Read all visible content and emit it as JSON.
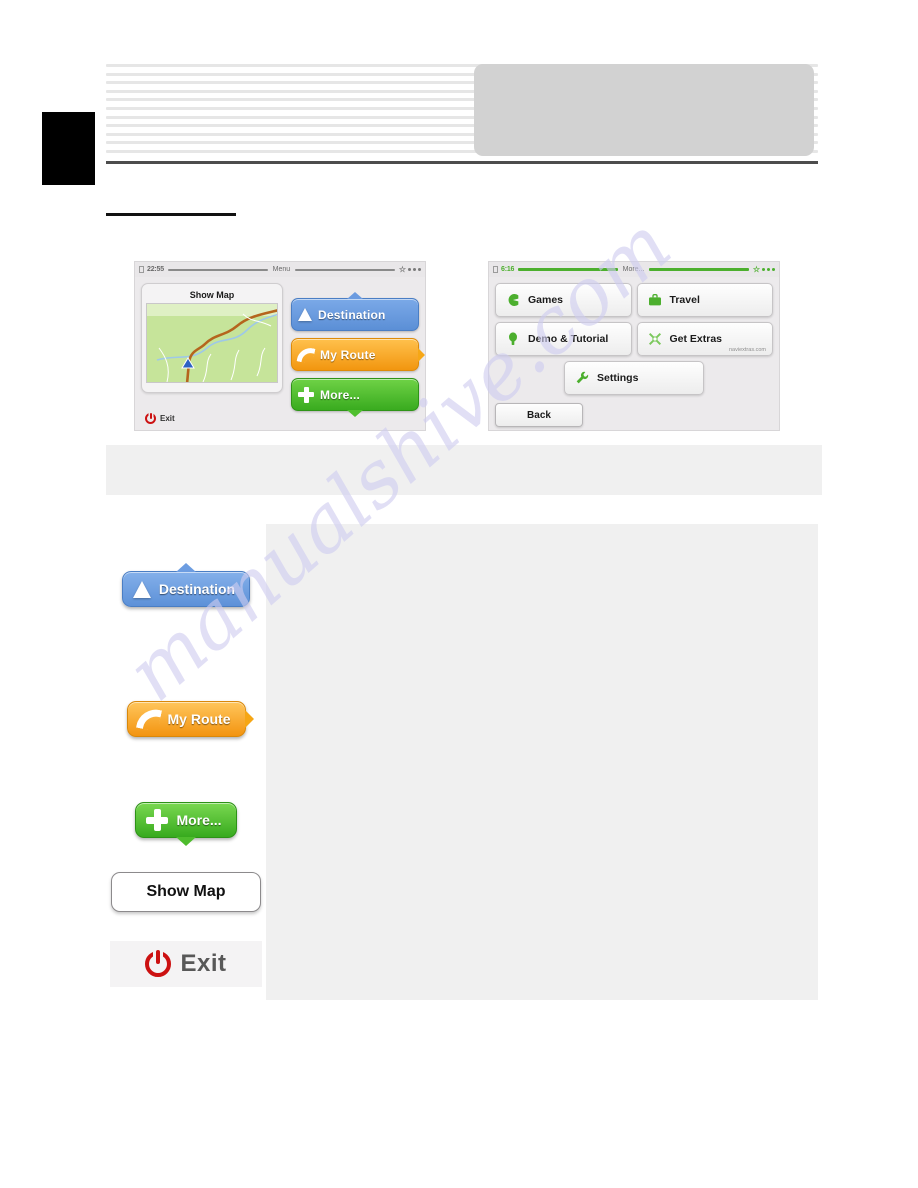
{
  "page": {
    "background": "#ffffff",
    "header_rule_color": "#4d4d4d",
    "section_rule_color": "#111111",
    "redacted_line_count": 11
  },
  "watermark": {
    "text": "manualshive.com",
    "color": "#cfcdf0"
  },
  "devices": {
    "left": {
      "statusbar": {
        "time": "22:55",
        "title": "Menu",
        "bar_color": "#8a8a8a",
        "satellite_icon": "satellite-icon"
      },
      "show_map": {
        "label": "Show Map",
        "map_icon": "map-thumbnail"
      },
      "exit": {
        "label": "Exit",
        "icon": "power-icon",
        "color": "#cc1111"
      },
      "buttons": [
        {
          "label": "Destination",
          "icon": "arrow-up-icon",
          "color": "#5d91d8"
        },
        {
          "label": "My Route",
          "icon": "route-curve-icon",
          "color": "#f39410"
        },
        {
          "label": "More...",
          "icon": "plus-icon",
          "color": "#37aa1e"
        }
      ]
    },
    "right": {
      "statusbar": {
        "time": "6:16",
        "title": "More...",
        "bar_color": "#4caf2e",
        "satellite_icon": "satellite-icon"
      },
      "tiles": [
        {
          "label": "Games",
          "icon": "games-icon",
          "sub": ""
        },
        {
          "label": "Travel",
          "icon": "suitcase-icon",
          "sub": ""
        },
        {
          "label": "Demo & Tutorial",
          "icon": "bulb-icon",
          "sub": ""
        },
        {
          "label": "Get Extras",
          "icon": "extras-icon",
          "sub": "naviextras.com"
        }
      ],
      "settings": {
        "label": "Settings",
        "icon": "wrench-icon"
      },
      "back": {
        "label": "Back"
      }
    }
  },
  "table": {
    "rows": [
      {
        "button_label": "Destination",
        "style": "destination",
        "description": ""
      },
      {
        "button_label": "My Route",
        "style": "my-route",
        "description": ""
      },
      {
        "button_label": "More...",
        "style": "more",
        "description": ""
      },
      {
        "button_label": "Show Map",
        "style": "show-map",
        "description": ""
      },
      {
        "button_label": "Exit",
        "style": "exit",
        "description": ""
      }
    ]
  }
}
